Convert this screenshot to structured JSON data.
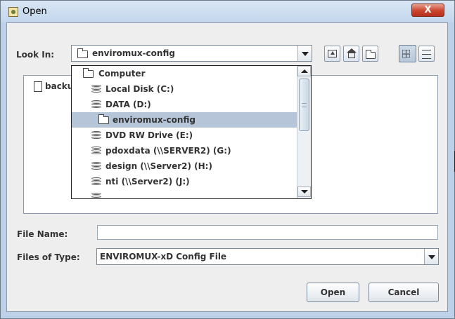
{
  "window": {
    "title": "Open",
    "close_label": "X"
  },
  "look_in": {
    "label": "Look In:",
    "value": "enviromux-config"
  },
  "toolbar": {
    "up_icon": "up-folder-icon",
    "home_icon": "home-icon",
    "new_folder_icon": "new-folder-icon",
    "list_icon": "list-view-icon",
    "details_icon": "details-view-icon"
  },
  "file_list": {
    "items": [
      {
        "name": "backu",
        "icon": "document-icon"
      }
    ]
  },
  "dropdown": {
    "items": [
      {
        "label": "Computer",
        "icon": "computer-folder-icon",
        "selected": false
      },
      {
        "label": "Local Disk (C:)",
        "icon": "disk-icon",
        "selected": false
      },
      {
        "label": "DATA (D:)",
        "icon": "disk-icon",
        "selected": false
      },
      {
        "label": "enviromux-config",
        "icon": "folder-icon",
        "selected": true
      },
      {
        "label": "DVD RW Drive (E:)",
        "icon": "disk-icon",
        "selected": false
      },
      {
        "label": "pdoxdata (\\\\SERVER2) (G:)",
        "icon": "disk-icon",
        "selected": false
      },
      {
        "label": "design (\\\\Server2) (H:)",
        "icon": "disk-icon",
        "selected": false
      },
      {
        "label": "nti (\\\\Server2) (J:)",
        "icon": "disk-icon",
        "selected": false
      }
    ]
  },
  "file_name": {
    "label": "File Name:",
    "value": ""
  },
  "files_of_type": {
    "label": "Files of Type:",
    "value": "ENVIROMUX-xD Config File"
  },
  "buttons": {
    "open": "Open",
    "cancel": "Cancel"
  }
}
